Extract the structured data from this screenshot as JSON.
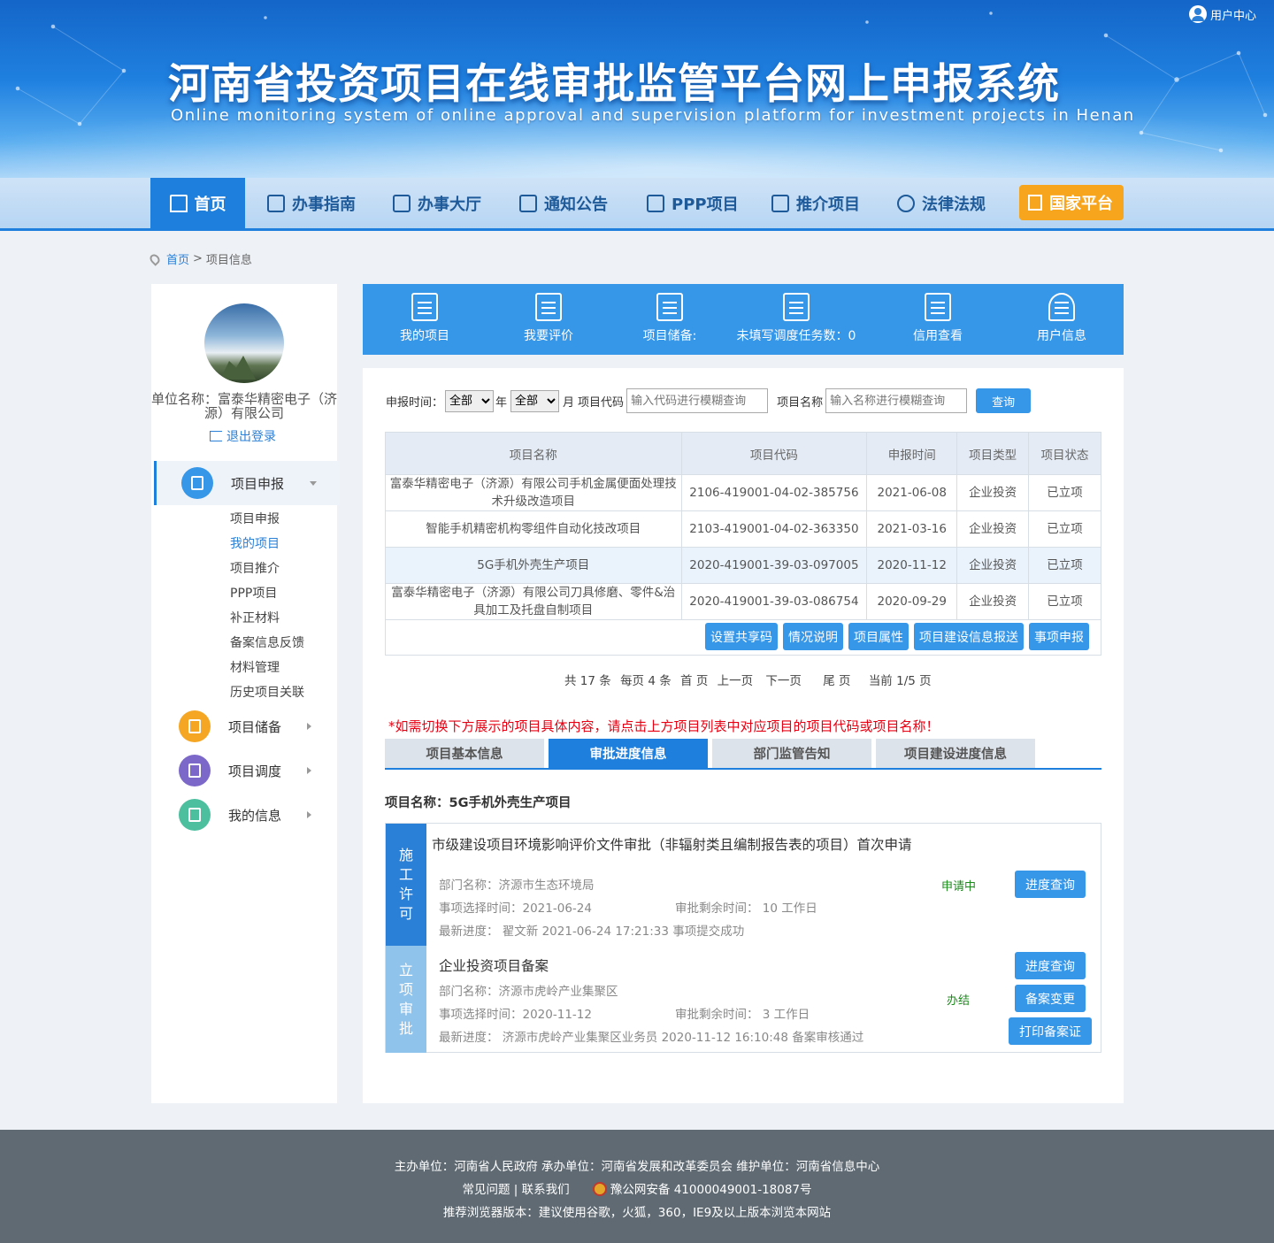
{
  "header": {
    "title": "河南省投资项目在线审批监管平台网上申报系统",
    "subtitle": "Online monitoring system of online approval and supervision platform for investment projects in Henan",
    "user_center": "用户中心"
  },
  "nav": {
    "items": [
      {
        "label": "首页",
        "icon": "home-icon"
      },
      {
        "label": "办事指南",
        "icon": "guide-icon"
      },
      {
        "label": "办事大厅",
        "icon": "building-icon"
      },
      {
        "label": "通知公告",
        "icon": "notice-icon"
      },
      {
        "label": "PPP项目",
        "icon": "ppp-icon"
      },
      {
        "label": "推介项目",
        "icon": "recommend-icon"
      },
      {
        "label": "法律法规",
        "icon": "law-icon"
      }
    ],
    "national": "国家平台"
  },
  "breadcrumb": {
    "home": "首页",
    "sep": ">",
    "current": "项目信息"
  },
  "sidebar": {
    "unit_name": "单位名称：富泰华精密电子（济源）有限公司",
    "logout": "退出登录",
    "groups": [
      {
        "label": "项目申报",
        "color": "#3696e8"
      },
      {
        "label": "项目储备",
        "color": "#f5a623"
      },
      {
        "label": "项目调度",
        "color": "#7b68c9"
      },
      {
        "label": "我的信息",
        "color": "#4bbf9e"
      }
    ],
    "sub_items": [
      "项目申报",
      "我的项目",
      "项目推介",
      "PPP项目",
      "补正材料",
      "备案信息反馈",
      "材料管理",
      "历史项目关联"
    ]
  },
  "quickbar": [
    {
      "label": "我的项目"
    },
    {
      "label": "我要评价"
    },
    {
      "label": "项目储备:"
    },
    {
      "label": "未填写调度任务数：0"
    },
    {
      "label": "信用查看"
    },
    {
      "label": "用户信息"
    }
  ],
  "filter": {
    "time_label": "申报时间：",
    "year_value": "全部",
    "year_unit": "年",
    "month_value": "全部",
    "month_unit": "月",
    "code_label": "项目代码",
    "code_placeholder": "输入代码进行模糊查询",
    "name_label": "项目名称",
    "name_placeholder": "输入名称进行模糊查询",
    "query": "查询"
  },
  "table": {
    "headers": [
      "项目名称",
      "项目代码",
      "申报时间",
      "项目类型",
      "项目状态"
    ],
    "rows": [
      [
        "富泰华精密电子（济源）有限公司手机金属便面处理技术升级改造项目",
        "2106-419001-04-02-385756",
        "2021-06-08",
        "企业投资",
        "已立项"
      ],
      [
        "智能手机精密机构零组件自动化技改项目",
        "2103-419001-04-02-363350",
        "2021-03-16",
        "企业投资",
        "已立项"
      ],
      [
        "5G手机外壳生产项目",
        "2020-419001-39-03-097005",
        "2020-11-12",
        "企业投资",
        "已立项"
      ],
      [
        "富泰华精密电子（济源）有限公司刀具修磨、零件&治具加工及托盘自制项目",
        "2020-419001-39-03-086754",
        "2020-09-29",
        "企业投资",
        "已立项"
      ]
    ],
    "actions": [
      "设置共享码",
      "情况说明",
      "项目属性",
      "项目建设信息报送",
      "事项申报"
    ]
  },
  "pager": {
    "total": "共 17 条",
    "per_page": "每页 4 条",
    "first": "首 页",
    "prev": "上一页",
    "next": "下一页",
    "last": "尾 页",
    "current": "当前 1/5 页"
  },
  "notice": "*如需切换下方展示的项目具体内容，请点击上方项目列表中对应项目的项目代码或项目名称！",
  "tabs": [
    "项目基本信息",
    "审批进度信息",
    "部门监管告知",
    "项目建设进度信息"
  ],
  "project_name": "项目名称：5G手机外壳生产项目",
  "steps": [
    {
      "stage": "施工许可",
      "stage_color": "#2a7fd6",
      "title": "市级建设项目环境影响评价文件审批（非辐射类且编制报告表的项目）首次申请",
      "dept": "部门名称：济源市生态环境局",
      "select_time": "事项选择时间：2021-06-24",
      "remain": "审批剩余时间：  10 工作日",
      "latest": "最新进度：  翟文新 2021-06-24 17:21:33  事项提交成功",
      "status": "申请中",
      "buttons": [
        "进度查询"
      ]
    },
    {
      "stage": "立项审批",
      "stage_color": "#8fc3ec",
      "title": "企业投资项目备案",
      "dept": "部门名称：济源市虎岭产业集聚区",
      "select_time": "事项选择时间：2020-11-12",
      "remain": "审批剩余时间：  3 工作日",
      "latest": "最新进度：  济源市虎岭产业集聚区业务员 2020-11-12 16:10:48 备案审核通过",
      "status": "办结",
      "buttons": [
        "进度查询",
        "备案变更",
        "打印备案证"
      ]
    }
  ],
  "footer": {
    "line1": "主办单位：河南省人民政府       承办单位：河南省发展和改革委员会       维护单位：河南省信息中心",
    "faq": "常见问题",
    "sep": " | ",
    "contact": "联系我们",
    "police": "豫公网安备 41000049001-18087号",
    "line3": "推荐浏览器版本：建议使用谷歌，火狐，360，IE9及以上版本浏览本网站"
  }
}
